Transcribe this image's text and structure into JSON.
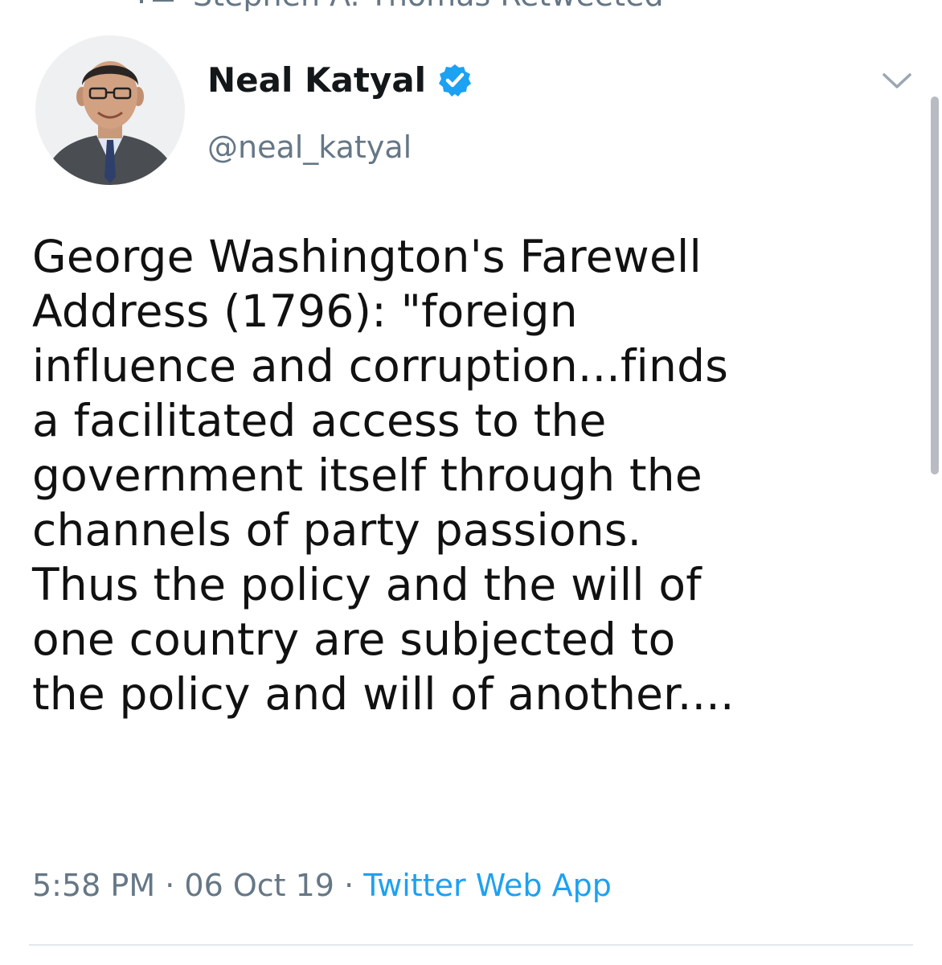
{
  "retweet_bar": {
    "text": "Stephen A. Thomas Retweeted",
    "icon": "retweet-icon"
  },
  "user": {
    "display_name": "Neal Katyal",
    "handle": "@neal_katyal",
    "verified_icon": "verified-badge-icon",
    "avatar": "avatar"
  },
  "tweet": {
    "lines": [
      "George Washington's Farewell",
      "Address (1796): \"foreign",
      "influence and corruption...finds",
      "a facilitated access to the",
      "government itself through the",
      "channels of party passions.",
      "Thus the policy and the will of",
      "one country are subjected to",
      "the policy and will of another...."
    ],
    "time": "5:58 PM",
    "date": "06 Oct 19",
    "separator": "·",
    "source": "Twitter Web App"
  },
  "colors": {
    "accent": "#1da1f2",
    "secondary_text": "#657786",
    "divider": "#e1e8ed"
  }
}
